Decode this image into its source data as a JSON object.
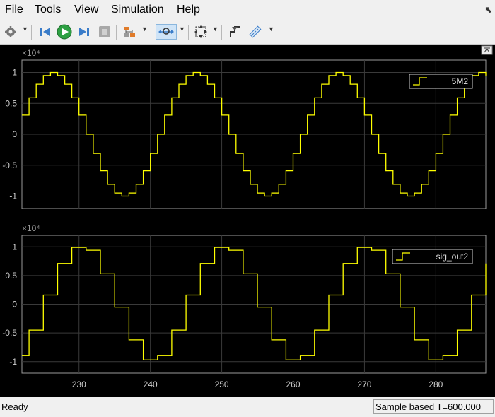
{
  "menu": [
    "File",
    "Tools",
    "View",
    "Simulation",
    "Help"
  ],
  "toolbar": {
    "icons": [
      "gear-icon",
      "step-back-icon",
      "run-icon",
      "step-forward-icon",
      "stop-icon",
      "signal-selector-icon",
      "zoom-icon",
      "fit-to-view-icon",
      "triggers-icon",
      "measurements-icon"
    ],
    "active": "zoom-icon"
  },
  "colors": {
    "background": "#000000",
    "axes": "#000000",
    "grid": "#3a3a3a",
    "signal": "#ffff00",
    "text": "#cccccc"
  },
  "chart_data": [
    {
      "type": "line",
      "step": true,
      "legend": [
        "5M2"
      ],
      "exponent_label": "×10⁴",
      "xlim": [
        222,
        287
      ],
      "ylim": [
        -1.2,
        1.2
      ],
      "yticks": [
        1,
        0.5,
        0,
        -0.5,
        -1
      ],
      "ytick_labels": [
        "1",
        "0.5",
        "0",
        "-0.5",
        "-1"
      ],
      "grid": true,
      "legend_position": "top-right",
      "series": [
        {
          "name": "5M2",
          "x": [
            222,
            223,
            224,
            225,
            226,
            227,
            228,
            229,
            230,
            231,
            232,
            233,
            234,
            235,
            236,
            237,
            238,
            239,
            240,
            241,
            242,
            243,
            244,
            245,
            246,
            247,
            248,
            249,
            250,
            251,
            252,
            253,
            254,
            255,
            256,
            257,
            258,
            259,
            260,
            261,
            262,
            263,
            264,
            265,
            266,
            267,
            268,
            269,
            270,
            271,
            272,
            273,
            274,
            275,
            276,
            277,
            278,
            279,
            280,
            281,
            282,
            283,
            284,
            285,
            286,
            287
          ],
          "values": [
            0.31,
            0.59,
            0.81,
            0.95,
            1.0,
            0.95,
            0.81,
            0.59,
            0.31,
            0.0,
            -0.31,
            -0.59,
            -0.81,
            -0.95,
            -1.0,
            -0.95,
            -0.81,
            -0.59,
            -0.31,
            0.0,
            0.31,
            0.59,
            0.81,
            0.95,
            1.0,
            0.95,
            0.81,
            0.59,
            0.31,
            0.0,
            -0.31,
            -0.59,
            -0.81,
            -0.95,
            -1.0,
            -0.95,
            -0.81,
            -0.59,
            -0.31,
            0.0,
            0.31,
            0.59,
            0.81,
            0.95,
            1.0,
            0.95,
            0.81,
            0.59,
            0.31,
            0.0,
            -0.31,
            -0.59,
            -0.81,
            -0.95,
            -1.0,
            -0.95,
            -0.81,
            -0.59,
            -0.31,
            0.0,
            0.31,
            0.59,
            0.81,
            0.95,
            1.0,
            0.95
          ]
        }
      ]
    },
    {
      "type": "line",
      "step": true,
      "legend": [
        "sig_out2"
      ],
      "exponent_label": "×10⁴",
      "xlim": [
        222,
        287
      ],
      "ylim": [
        -1.2,
        1.2
      ],
      "yticks": [
        1,
        0.5,
        0,
        -0.5,
        -1
      ],
      "ytick_labels": [
        "1",
        "0.5",
        "0",
        "-0.5",
        "-1"
      ],
      "xticks": [
        230,
        240,
        250,
        260,
        270,
        280
      ],
      "xtick_labels": [
        "230",
        "240",
        "250",
        "260",
        "270",
        "280"
      ],
      "grid": true,
      "legend_position": "top-right",
      "series": [
        {
          "name": "sig_out2",
          "x": [
            222,
            223,
            224,
            225,
            226,
            227,
            228,
            229,
            230,
            231,
            232,
            233,
            234,
            235,
            236,
            237,
            238,
            239,
            240,
            241,
            242,
            243,
            244,
            245,
            246,
            247,
            248,
            249,
            250,
            251,
            252,
            253,
            254,
            255,
            256,
            257,
            258,
            259,
            260,
            261,
            262,
            263,
            264,
            265,
            266,
            267,
            268,
            269,
            270,
            271,
            272,
            273,
            274,
            275,
            276,
            277,
            278,
            279,
            280,
            281,
            282,
            283,
            284,
            285,
            286,
            287
          ],
          "values": [
            -0.89,
            -0.45,
            -0.45,
            0.16,
            0.16,
            0.71,
            0.71,
            0.99,
            0.99,
            0.94,
            0.94,
            0.53,
            0.53,
            -0.05,
            -0.05,
            -0.62,
            -0.62,
            -0.97,
            -0.97,
            -0.89,
            -0.89,
            -0.45,
            -0.45,
            0.16,
            0.16,
            0.71,
            0.71,
            0.99,
            0.99,
            0.94,
            0.94,
            0.53,
            0.53,
            -0.05,
            -0.05,
            -0.62,
            -0.62,
            -0.97,
            -0.97,
            -0.89,
            -0.89,
            -0.45,
            -0.45,
            0.16,
            0.16,
            0.71,
            0.71,
            0.99,
            0.99,
            0.94,
            0.94,
            0.53,
            0.53,
            -0.05,
            -0.05,
            -0.62,
            -0.62,
            -0.97,
            -0.97,
            -0.89,
            -0.89,
            -0.45,
            -0.45,
            0.16,
            0.16,
            0.71
          ]
        }
      ]
    }
  ],
  "status": {
    "left": "Ready",
    "right": "Sample based   T=600.000"
  }
}
